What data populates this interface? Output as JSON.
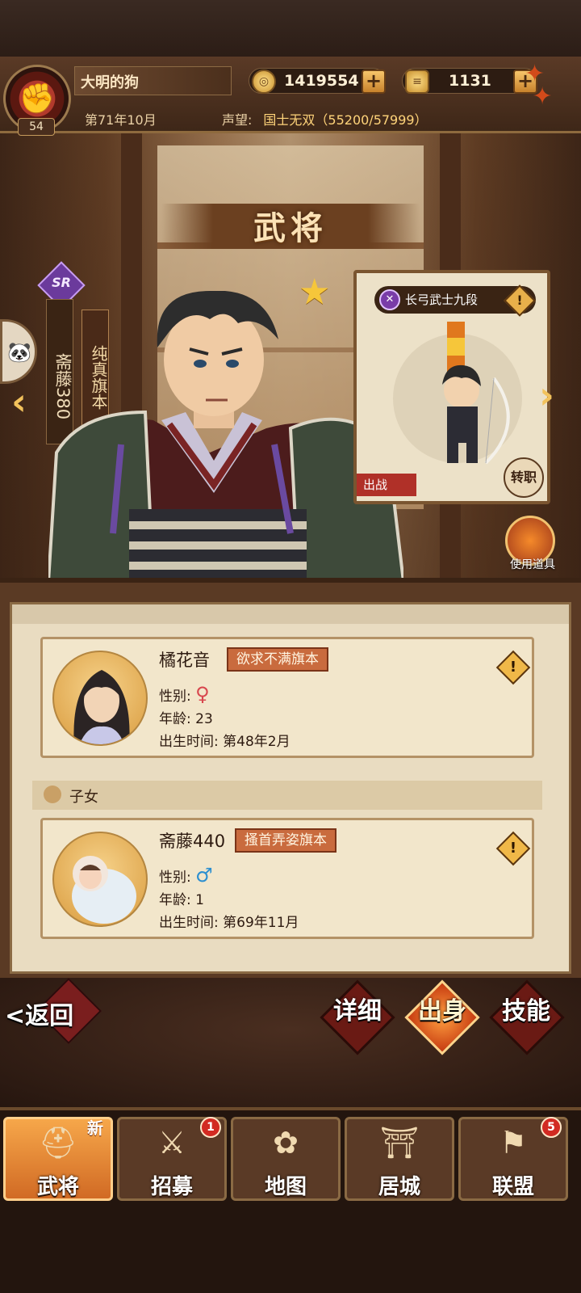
{
  "player": {
    "name": "大明的狗",
    "level": "54",
    "date": "第71年10月",
    "prestige_label": "声望:",
    "prestige_value": "国士无双（55200/57999）"
  },
  "resources": {
    "coins": "1419554",
    "gold": "1131"
  },
  "page_title": "武将",
  "general": {
    "rarity": "SR",
    "name": "斋藤380",
    "title": "纯真旗本",
    "stars": 1
  },
  "unit_card": {
    "class_name": "长弓武士九段",
    "deploy_label": "出战",
    "transfer_label": "转职"
  },
  "use_item_label": "使用道具",
  "spouse": {
    "name": "橘花音",
    "tag": "欲求不满旗本",
    "gender_label": "性别:",
    "gender_symbol": "♀",
    "age_label": "年龄:",
    "age": "23",
    "birth_label": "出生时间:",
    "birth": "第48年2月"
  },
  "children_section": "子女",
  "child": {
    "name": "斋藤440",
    "tag": "搔首弄姿旗本",
    "gender_label": "性别:",
    "gender_symbol": "♂",
    "age_label": "年龄:",
    "age": "1",
    "birth_label": "出生时间:",
    "birth": "第69年11月"
  },
  "actions": {
    "back": "返回",
    "detail": "详细",
    "origin": "出身",
    "skill": "技能"
  },
  "nav": {
    "items": [
      {
        "label": "武将",
        "badge": "",
        "new": "新"
      },
      {
        "label": "招募",
        "badge": "1"
      },
      {
        "label": "地图",
        "badge": ""
      },
      {
        "label": "居城",
        "badge": ""
      },
      {
        "label": "联盟",
        "badge": "5"
      }
    ]
  },
  "colors": {
    "accent": "#f6c63a",
    "active_tab": "#e0701e",
    "badge": "#d22a22"
  }
}
